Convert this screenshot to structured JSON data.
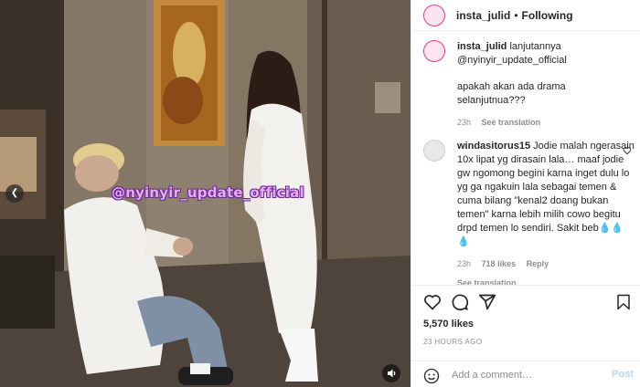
{
  "post": {
    "username": "insta_julid",
    "separator": "•",
    "follow_label": "Following",
    "watermark": "@nyinyir_update_official"
  },
  "caption": {
    "username": "insta_julid",
    "text_line1": "lanjutannya",
    "text_line2": "@nyinyir_update_official",
    "text_line3": "apakah akan ada drama",
    "text_line4": "selanjutnua???",
    "time": "23h",
    "see_translation": "See translation"
  },
  "comment": {
    "username": "windasitorus15",
    "text": "Jodie malah ngerasain 10x lipat yg dirasain lala… maaf jodie gw ngomong begini karna inget dulu lo yg ga ngakuin lala sebagai temen & cuma bilang \"kenal2 doang bukan temen\" karna lebih milih cowo begitu drpd temen lo sendiri. Sakit beb💧💧💧",
    "time": "23h",
    "likes": "718 likes",
    "reply": "Reply",
    "see_translation": "See translation"
  },
  "stats": {
    "likes": "5,570 likes",
    "time_ago": "23 HOURS AGO"
  },
  "add_comment": {
    "placeholder": "Add a comment…",
    "post_label": "Post"
  },
  "colors": {
    "link": "#0095f6",
    "muted": "#8e8e8e",
    "post_disabled": "#b3dbff",
    "avatar_ring": "#e63b86"
  },
  "icons": [
    "heart-icon",
    "comment-icon",
    "share-icon",
    "bookmark-icon",
    "emoji-icon",
    "volume-icon",
    "chevron-left-icon"
  ]
}
